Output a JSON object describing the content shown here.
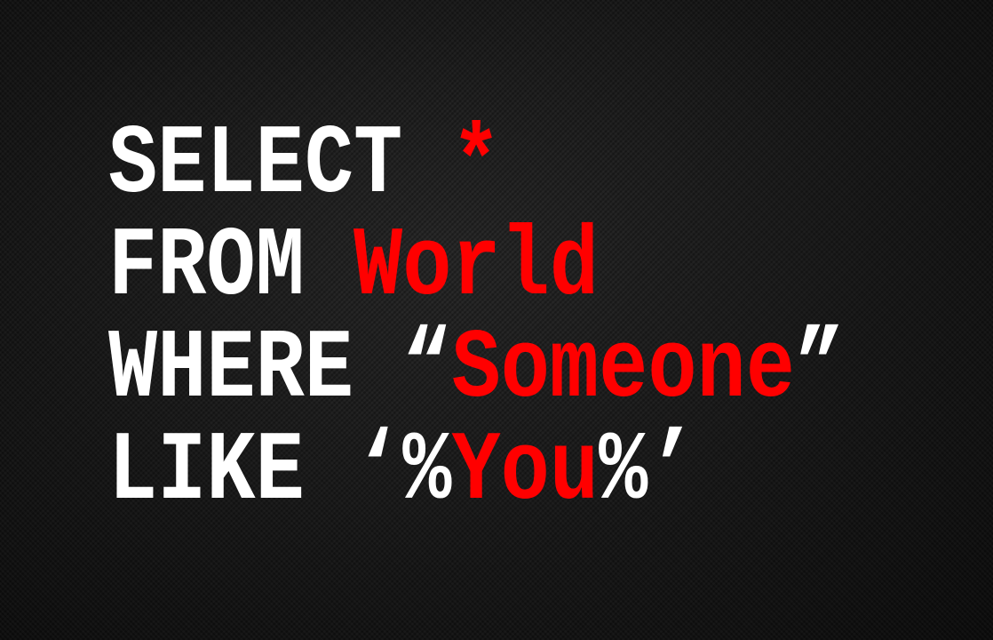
{
  "colors": {
    "keyword": "#ffffff",
    "value": "#ff0000",
    "background": "#161616"
  },
  "lines": [
    {
      "keyword": "SELECT ",
      "value": "*"
    },
    {
      "keyword": "FROM ",
      "value": "World"
    },
    {
      "keyword": "WHERE ",
      "open": "“",
      "value": "Someone",
      "close": "”"
    },
    {
      "keyword": "LIKE ",
      "open": "‘%",
      "value": "You",
      "close": "%’"
    }
  ]
}
